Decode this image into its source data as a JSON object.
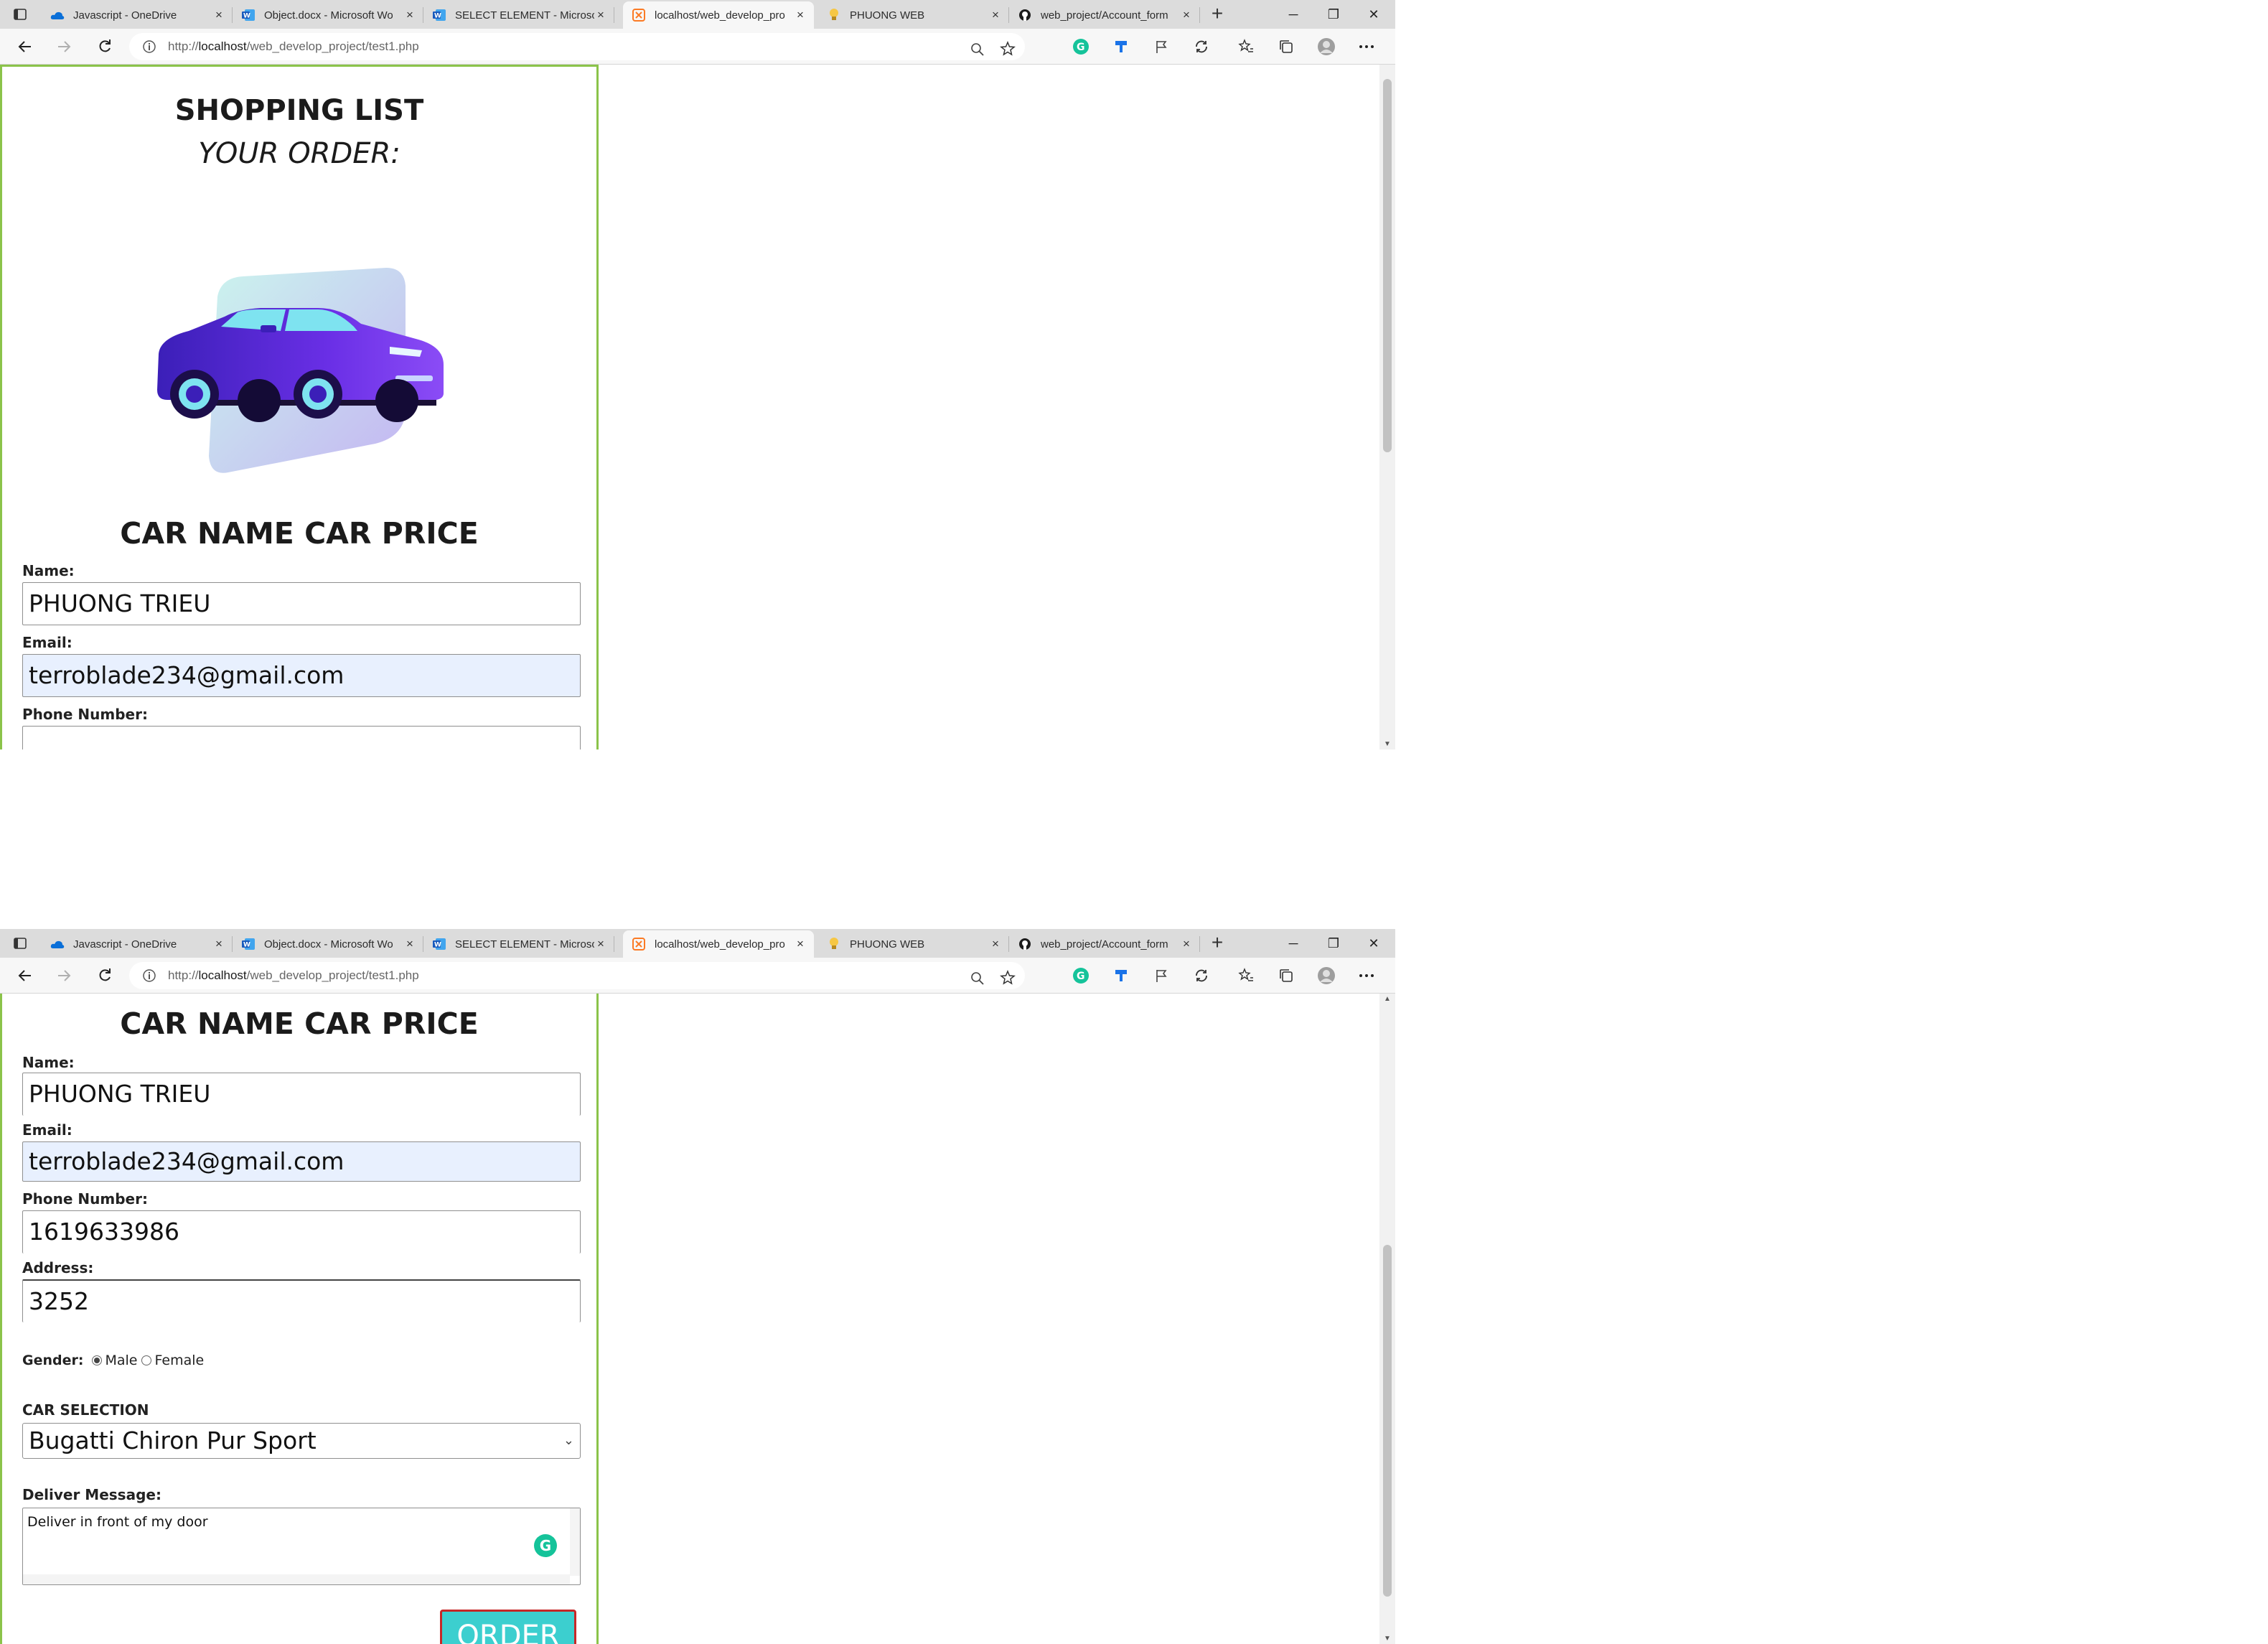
{
  "browser": {
    "tabs": [
      {
        "title": "Javascript - OneDrive",
        "icon": "onedrive-icon"
      },
      {
        "title": "Object.docx - Microsoft Wo",
        "icon": "word-icon"
      },
      {
        "title": "SELECT ELEMENT - Microso",
        "icon": "word-icon"
      },
      {
        "title": "localhost/web_develop_pro",
        "icon": "xampp-icon",
        "active": true
      },
      {
        "title": "PHUONG WEB",
        "icon": "bulb-icon"
      },
      {
        "title": "web_project/Account_form",
        "icon": "github-icon"
      }
    ],
    "tab_close": "×",
    "new_tab": "+",
    "url_prefix": "http://",
    "url_host": "localhost",
    "url_path": "/web_develop_project/test1.php"
  },
  "page": {
    "heading": "SHOPPING LIST",
    "subheading": "YOUR ORDER:",
    "car_heading": "CAR NAME CAR PRICE",
    "form": {
      "name_label": "Name:",
      "name_value": "PHUONG TRIEU",
      "email_label": "Email:",
      "email_value": "terroblade234@gmail.com",
      "phone_label": "Phone Number:",
      "phone_value": "1619633986",
      "address_label": "Address:",
      "address_value": "3252",
      "gender_label": "Gender:",
      "gender_male": "Male",
      "gender_female": "Female",
      "gender_selected": "Male",
      "car_selection_label": "CAR SELECTION",
      "car_selected": "Bugatti Chiron Pur Sport",
      "message_label": "Deliver Message:",
      "message_value": "Deliver in front of my door",
      "order_button": "ORDER"
    }
  },
  "colors": {
    "panel_border": "#8bc34a",
    "autofill_bg": "#e8f0fe",
    "order_bg": "#3ccfcf",
    "order_border": "#c62828",
    "grammarly": "#15c39a"
  }
}
